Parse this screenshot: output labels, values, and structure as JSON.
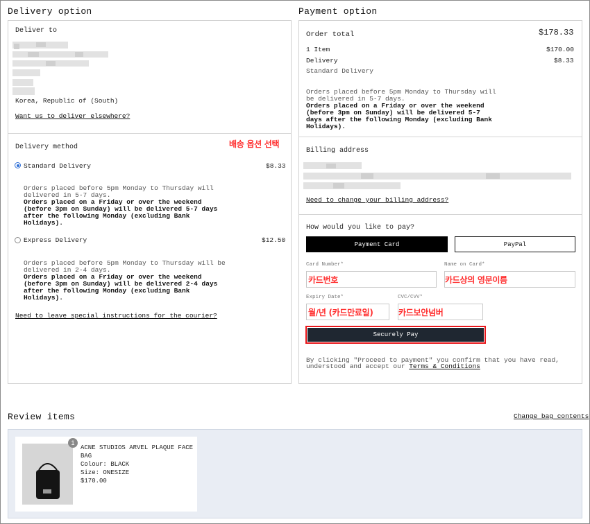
{
  "delivery": {
    "title": "Delivery option",
    "deliver_to_label": "Deliver to",
    "country": "Korea, Republic of (South)",
    "deliver_elsewhere_link": "Want us to deliver elsewhere?",
    "method_title": "Delivery method",
    "annotation": "배송 옵션 선택",
    "options": [
      {
        "name": "Standard Delivery",
        "price": "$8.33",
        "selected": true,
        "line1": "Orders placed before 5pm Monday to Thursday will",
        "line2": "delivered in 5-7 days.",
        "bold1": "Orders placed on a Friday or over the weekend",
        "bold2": "(before 3pm on Sunday) will be delivered 5-7 days",
        "bold3": "after the following Monday (excluding Bank",
        "bold4": "Holidays)."
      },
      {
        "name": "Express Delivery",
        "price": "$12.50",
        "selected": false,
        "line1": "Orders placed before 5pm Monday to Thursday will be",
        "line2": "delivered in 2-4 days.",
        "bold1": "Orders placed on a Friday or over the weekend",
        "bold2": "(before 3pm on Sunday) will be delivered 2-4 days",
        "bold3": "after the following Monday (excluding Bank",
        "bold4": "Holidays)."
      }
    ],
    "courier_link": "Need to leave special instructions for the courier?"
  },
  "payment": {
    "title": "Payment option",
    "order_total_label": "Order total",
    "order_total_value": "$178.33",
    "items_label": "1 Item",
    "items_value": "$170.00",
    "delivery_label": "Delivery",
    "delivery_value": "$8.33",
    "delivery_type": "Standard Delivery",
    "note_line1": "Orders placed before 5pm Monday to Thursday will",
    "note_line2": "be delivered in 5-7 days.",
    "note_bold1": "Orders placed on a Friday or over the weekend",
    "note_bold2": "(before 3pm on Sunday) will be delivered 5-7",
    "note_bold3": "days after the following Monday (excluding Bank",
    "note_bold4": "Holidays).",
    "billing_label": "Billing address",
    "billing_change_link": "Need to change your billing address?",
    "how_to_pay": "How would you like to pay?",
    "tab_card": "Payment Card",
    "tab_paypal": "PayPal",
    "card_number_label": "Card Number*",
    "card_number_annotation": "카드번호",
    "name_on_card_label": "Name on Card*",
    "name_on_card_annotation": "카드상의 영문이름",
    "expiry_label": "Expiry Date*",
    "expiry_annotation": "월/년 (카드만료일)",
    "cvc_label": "CVC/CVV*",
    "cvc_annotation": "카드보안넘버",
    "pay_button": "Securely Pay",
    "consent_line1": "By clicking \"Proceed to payment\" you confirm that you have read,",
    "consent_line2": "understood and accept our",
    "terms_link": "Terms & Conditions"
  },
  "review": {
    "title": "Review items",
    "change_bag_link": "Change bag contents",
    "item": {
      "badge": "1",
      "name_line1": "ACNE STUDIOS ARVEL PLAQUE FACE",
      "name_line2": "BAG",
      "colour": "Colour: BLACK",
      "size": "Size: ONESIZE",
      "price": "$170.00"
    }
  }
}
